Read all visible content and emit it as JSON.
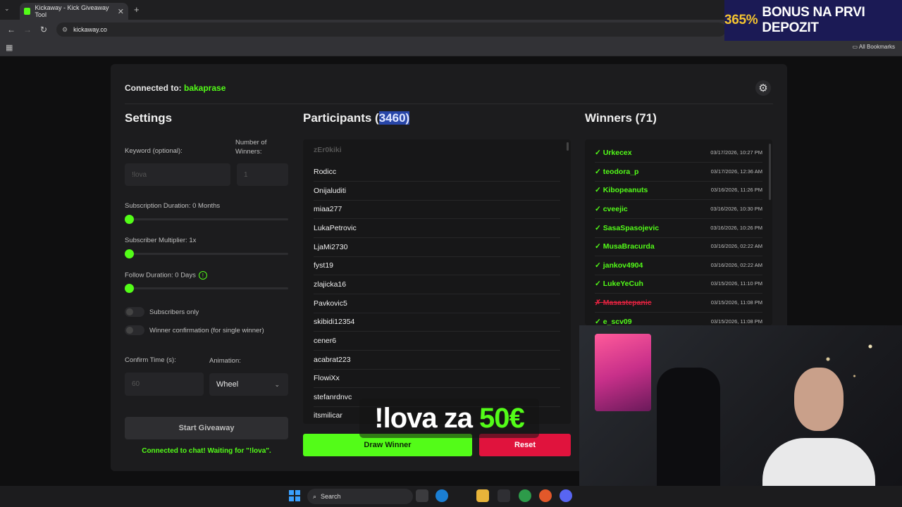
{
  "browser": {
    "tab_title": "Kickaway - Kick Giveaway Tool",
    "tab_close": "✕",
    "new_tab": "+",
    "url": "kickaway.co",
    "all_bookmarks": "All Bookmarks"
  },
  "ad_banner": {
    "highlight": "365%",
    "text": "BONUS NA PRVI DEPOZIT"
  },
  "header": {
    "connected_prefix": "Connected to: ",
    "channel": "bakaprase"
  },
  "settings": {
    "title": "Settings",
    "keyword_label": "Keyword (optional):",
    "keyword_placeholder": "!lova",
    "winners_label": "Number of Winners:",
    "winners_placeholder": "1",
    "sub_duration_label": "Subscription Duration: 0 Months",
    "sub_multiplier_label": "Subscriber Multiplier: 1x",
    "follow_duration_label": "Follow Duration:  0  Days",
    "subscribers_only_label": "Subscribers only",
    "winner_confirmation_label": "Winner confirmation (for single winner)",
    "confirm_time_label": "Confirm Time (s):",
    "confirm_time_placeholder": "60",
    "animation_label": "Animation:",
    "animation_value": "Wheel",
    "start_button": "Start Giveaway",
    "status": "Connected to chat! Waiting for \"!lova\"."
  },
  "participants": {
    "title_prefix": "Participants (",
    "count": "3460",
    "title_suffix": ")",
    "items": [
      "zEr0kiki",
      "Rodicc",
      "Onijaluditi",
      "miaa277",
      "LukaPetrovic",
      "LjaMi2730",
      "fyst19",
      "zlajicka16",
      "Pavkovic5",
      "skibidi12354",
      "cener6",
      "acabrat223",
      "FlowiXx",
      "stefanrdnvc",
      "itsmilicar"
    ]
  },
  "winners": {
    "title": "Winners (71)",
    "items": [
      {
        "name": "✓ Urkecex",
        "time": "03/17/2026, 10:27 PM",
        "status": "ok"
      },
      {
        "name": "✓ teodora_p",
        "time": "03/17/2026, 12:36 AM",
        "status": "ok"
      },
      {
        "name": "✓ Kibopeanuts",
        "time": "03/16/2026, 11:26 PM",
        "status": "ok"
      },
      {
        "name": "✓ cveejic",
        "time": "03/16/2026, 10:30 PM",
        "status": "ok"
      },
      {
        "name": "✓ SasaSpasojevic",
        "time": "03/16/2026, 10:26 PM",
        "status": "ok"
      },
      {
        "name": "✓ MusaBracurda",
        "time": "03/16/2026, 02:22 AM",
        "status": "ok"
      },
      {
        "name": "✓ jankov4904",
        "time": "03/16/2026, 02:22 AM",
        "status": "ok"
      },
      {
        "name": "✓ LukeYeCuh",
        "time": "03/15/2026, 11:10 PM",
        "status": "ok"
      },
      {
        "name": "✗ Masastepanic",
        "time": "03/15/2026, 11:08 PM",
        "status": "rejected"
      },
      {
        "name": "✓ e_scv09",
        "time": "03/15/2026, 11:08 PM",
        "status": "ok"
      }
    ]
  },
  "actions": {
    "draw_winner": "Draw Winner",
    "reset": "Reset"
  },
  "overlay": {
    "text": "!lova za",
    "amount": "50€"
  },
  "taskbar": {
    "search": "Search"
  },
  "colors": {
    "accent": "#53fc18",
    "danger": "#e0133d",
    "selection": "#2846a8"
  }
}
